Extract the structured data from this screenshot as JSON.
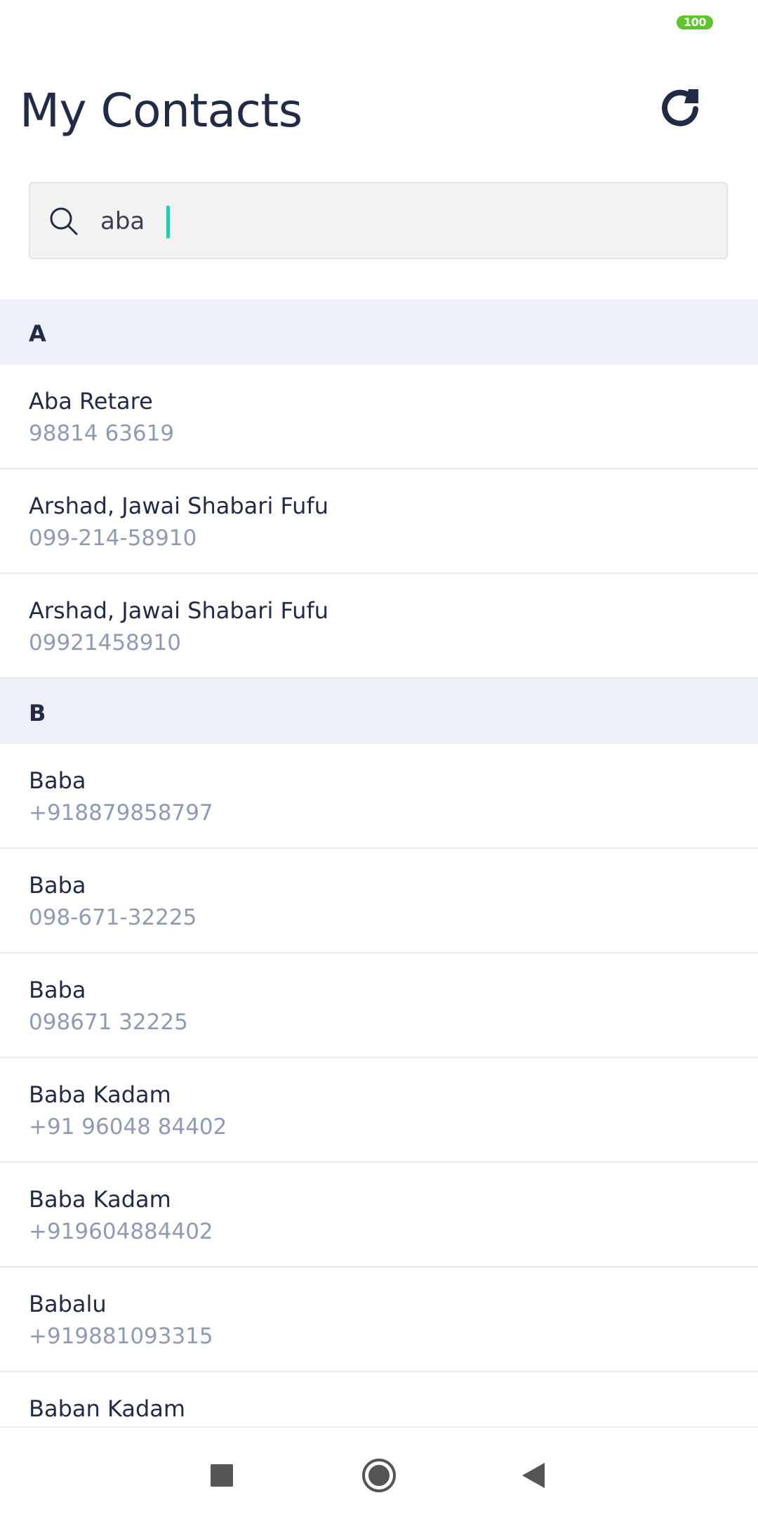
{
  "status_bar": {
    "battery_level": "100",
    "battery_color": "#5fc52e"
  },
  "header": {
    "title": "My Contacts",
    "refresh_icon": "refresh-icon"
  },
  "search": {
    "value": "aba",
    "icon": "search-icon",
    "caret_color": "#1bd1b3"
  },
  "sections": [
    {
      "letter": "A",
      "contacts": [
        {
          "name": "Aba Retare",
          "phone": "98814 63619"
        },
        {
          "name": "Arshad, Jawai Shabari Fufu",
          "phone": "099-214-58910"
        },
        {
          "name": "Arshad, Jawai Shabari Fufu",
          "phone": "09921458910"
        }
      ]
    },
    {
      "letter": "B",
      "contacts": [
        {
          "name": "Baba",
          "phone": "+918879858797"
        },
        {
          "name": "Baba",
          "phone": "098-671-32225"
        },
        {
          "name": "Baba",
          "phone": "098671 32225"
        },
        {
          "name": "Baba Kadam",
          "phone": "+91 96048 84402"
        },
        {
          "name": "Baba Kadam",
          "phone": "+919604884402"
        },
        {
          "name": "Babalu",
          "phone": "+919881093315"
        },
        {
          "name": "Baban Kadam",
          "phone": ""
        }
      ]
    }
  ],
  "nav_bar": {
    "recents_icon": "square-icon",
    "home_icon": "circle-icon",
    "back_icon": "triangle-back-icon"
  },
  "colors": {
    "title_text": "#222b45",
    "secondary_text": "#8f9bb3",
    "section_background": "#edf1f7"
  }
}
